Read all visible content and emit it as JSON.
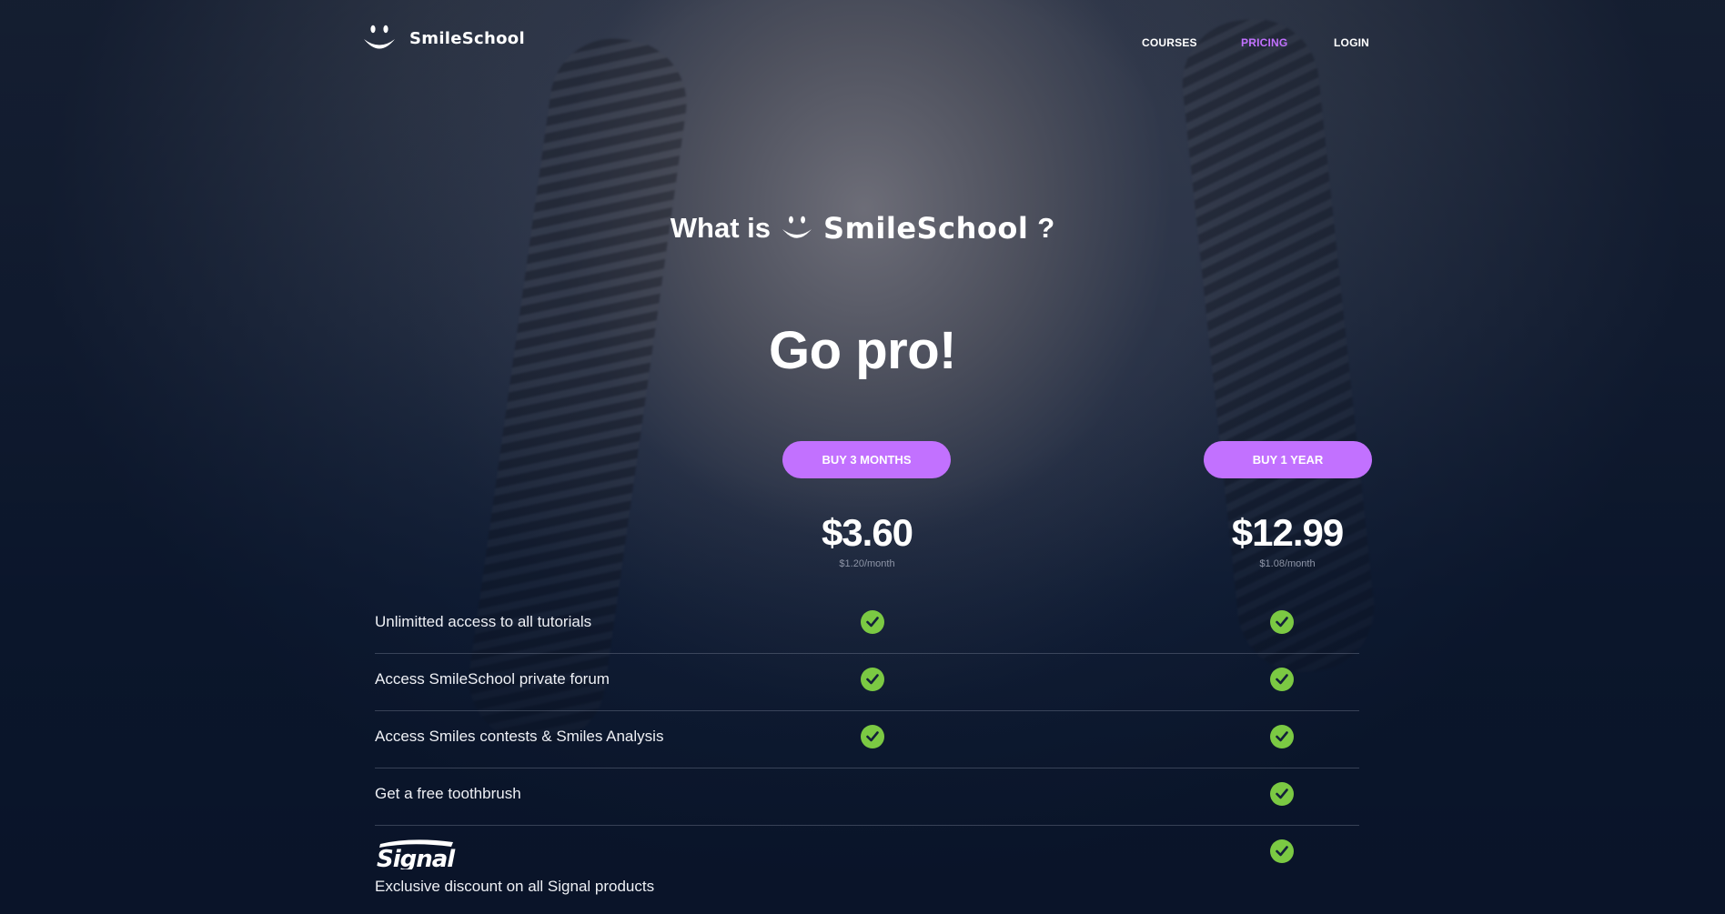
{
  "brand": {
    "name": "SmileSchool"
  },
  "nav": {
    "links": [
      {
        "label": "COURSES",
        "active": false
      },
      {
        "label": "PRICING",
        "active": true
      },
      {
        "label": "LOGIN",
        "active": false
      }
    ]
  },
  "hero": {
    "what_is_prefix": "What is",
    "what_is_brand": "SmileSchool",
    "what_is_suffix": "?",
    "heading": "Go pro!"
  },
  "plans": [
    {
      "button": "BUY 3 MONTHS",
      "price": "$3.60",
      "per_month": "$1.20/month"
    },
    {
      "button": "BUY 1 YEAR",
      "price": "$12.99",
      "per_month": "$1.08/month"
    }
  ],
  "features": [
    {
      "label": "Unlimitted access to all tutorials",
      "plan_3_months": true,
      "plan_1_year": true
    },
    {
      "label": "Access SmileSchool private forum",
      "plan_3_months": true,
      "plan_1_year": true
    },
    {
      "label": "Access Smiles contests & Smiles Analysis",
      "plan_3_months": true,
      "plan_1_year": true
    },
    {
      "label": "Get a free toothbrush",
      "plan_3_months": false,
      "plan_1_year": true
    },
    {
      "label": "Exclusive discount on all Signal products",
      "logo": "Signal",
      "plan_3_months": false,
      "plan_1_year": true
    }
  ],
  "colors": {
    "accent": "#c271ff",
    "check": "#7bc943",
    "background": "#0e1a31"
  },
  "icons": {
    "brand_logo": "smiley-face-icon",
    "check": "check-circle-icon",
    "partner_logo": "signal-logo"
  }
}
